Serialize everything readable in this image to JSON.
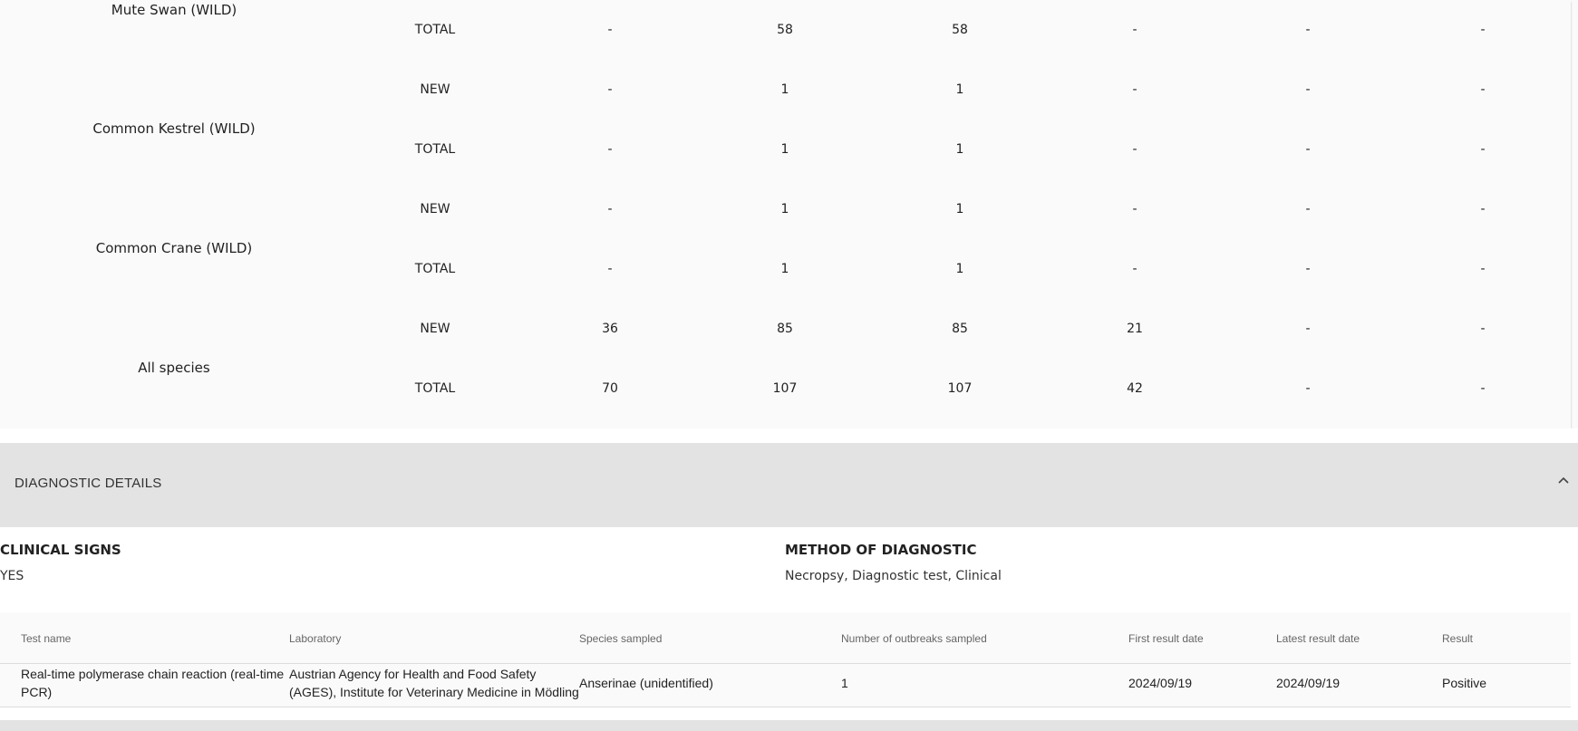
{
  "species_table": {
    "top_species": "Mute Swan (WILD)",
    "top_total": [
      "TOTAL",
      "-",
      "58",
      "58",
      "-",
      "-",
      "-"
    ],
    "groups": [
      {
        "name": "Common Kestrel (WILD)",
        "new": [
          "NEW",
          "-",
          "1",
          "1",
          "-",
          "-",
          "-"
        ],
        "total": [
          "TOTAL",
          "-",
          "1",
          "1",
          "-",
          "-",
          "-"
        ]
      },
      {
        "name": "Common Crane (WILD)",
        "new": [
          "NEW",
          "-",
          "1",
          "1",
          "-",
          "-",
          "-"
        ],
        "total": [
          "TOTAL",
          "-",
          "1",
          "1",
          "-",
          "-",
          "-"
        ]
      },
      {
        "name": "All species",
        "new": [
          "NEW",
          "36",
          "85",
          "85",
          "21",
          "-",
          "-"
        ],
        "total": [
          "TOTAL",
          "70",
          "107",
          "107",
          "42",
          "-",
          "-"
        ]
      }
    ]
  },
  "diagnostic": {
    "title": "DIAGNOSTIC DETAILS",
    "clinical_signs_label": "CLINICAL SIGNS",
    "clinical_signs_value": "YES",
    "method_label": "METHOD OF DIAGNOSTIC",
    "method_value": "Necropsy, Diagnostic test, Clinical"
  },
  "tests_table": {
    "headers": [
      "Test name",
      "Laboratory",
      "Species sampled",
      "Number of outbreaks sampled",
      "First result date",
      "Latest result date",
      "Result"
    ],
    "rows": [
      [
        "Real-time polymerase chain reaction (real-time PCR)",
        "Austrian Agency for Health and Food Safety (AGES), Institute for Veterinary Medicine in Mödling",
        "Anserinae (unidentified)",
        "1",
        "2024/09/19",
        "2024/09/19",
        "Positive"
      ]
    ]
  },
  "icons": {
    "collapse": "chevron-up-icon"
  }
}
